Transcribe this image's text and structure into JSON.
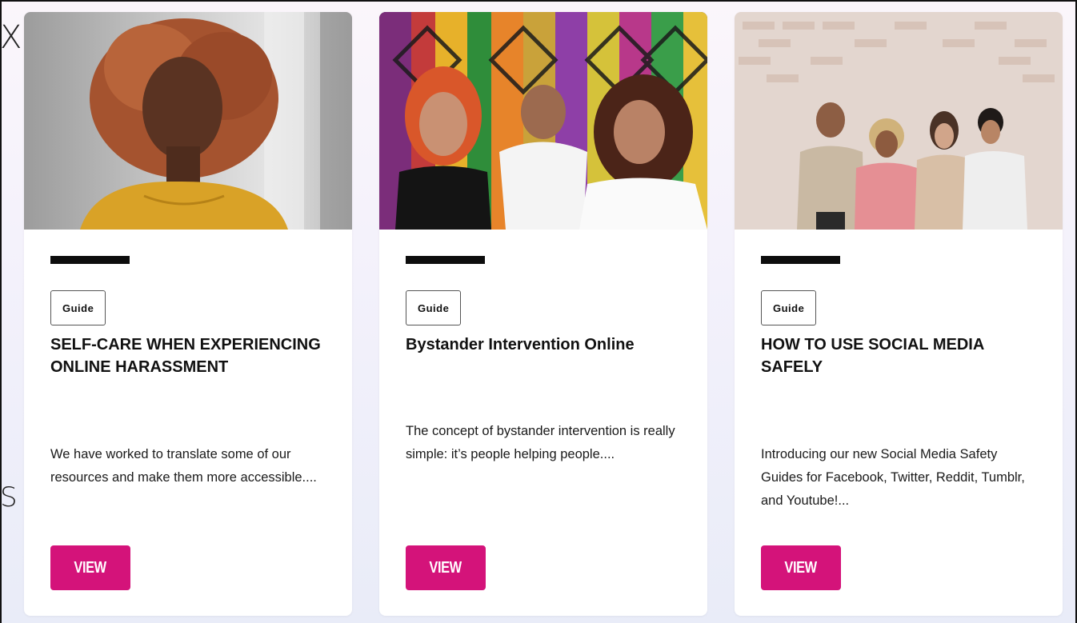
{
  "edge_glyphs": {
    "top": "X",
    "bottom": "S"
  },
  "cards": [
    {
      "image": {
        "icon": "portrait-photo",
        "alt": "woman with curly red hair, eyes closed, yellow sweater"
      },
      "tag": "Guide",
      "title": "SELF-CARE WHEN EXPERIENCING ONLINE HARASSMENT",
      "description": "We have worked to translate some of our resources and make them more accessible....",
      "button": "VIEW"
    },
    {
      "image": {
        "icon": "group-photo",
        "alt": "three women in front of colorful geometric glass wall"
      },
      "tag": "Guide",
      "title": "Bystander Intervention Online",
      "description": "The concept of bystander intervention is really simple: it’s people helping people....",
      "button": "VIEW"
    },
    {
      "image": {
        "icon": "group-photo",
        "alt": "four young people on phones in front of brick wall"
      },
      "tag": "Guide",
      "title": "HOW TO USE SOCIAL MEDIA SAFELY",
      "description": "Introducing our new Social Media Safety Guides for Facebook, Twitter, Reddit, Tumblr, and Youtube!...",
      "button": "VIEW"
    }
  ],
  "colors": {
    "button": "#d4137a",
    "accent_bar": "#0d0d0d",
    "background_top": "#fbf6fb",
    "background_bottom": "#e9ecf8"
  }
}
